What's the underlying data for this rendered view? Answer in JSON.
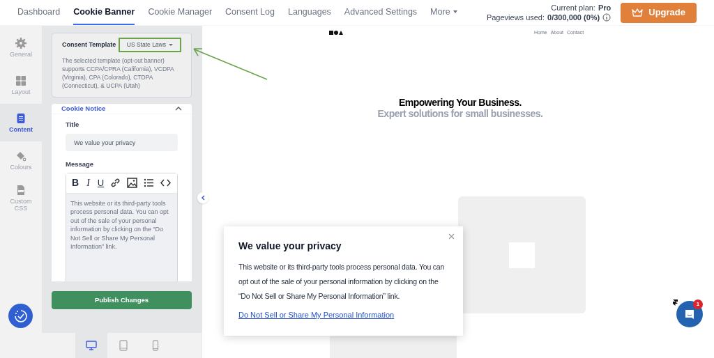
{
  "nav": {
    "tabs": [
      {
        "label": "Dashboard",
        "selected": false
      },
      {
        "label": "Cookie Banner",
        "selected": true
      },
      {
        "label": "Cookie Manager",
        "selected": false
      },
      {
        "label": "Consent Log",
        "selected": false
      },
      {
        "label": "Languages",
        "selected": false
      },
      {
        "label": "Advanced Settings",
        "selected": false
      },
      {
        "label": "More",
        "selected": false
      }
    ],
    "plan_label": "Current plan:",
    "plan": "Pro",
    "pageviews_label": "Pageviews used:",
    "pageviews": "0/300,000 (0%)",
    "upgrade": "Upgrade"
  },
  "sidebar": {
    "items": [
      {
        "kind": "gear",
        "label": "General",
        "selected": false
      },
      {
        "kind": "grid",
        "label": "Layout",
        "selected": false
      },
      {
        "kind": "doc",
        "label": "Content",
        "selected": true
      },
      {
        "kind": "paint",
        "label": "Colours",
        "selected": false
      },
      {
        "kind": "css",
        "label": "Custom CSS",
        "selected": false
      }
    ]
  },
  "template": {
    "label": "Consent Template",
    "value": "US State Laws",
    "description": "The selected template (opt-out banner) supports CCPA/CPRA (California), VCDPA (Virginia), CPA (Colorado), CTDPA (Connecticut), & UCPA (Utah)"
  },
  "cookie_notice": {
    "heading": "Cookie Notice",
    "expanded": true,
    "title_label": "Title",
    "title_value": "We value your privacy",
    "message_label": "Message",
    "message_value": "This website or its third-party tools process personal data. You can opt out of the sale of your personal information by clicking on the “Do Not Sell or Share My Personal Information” link."
  },
  "toolbar": [
    {
      "kind": "bold",
      "label": "B"
    },
    {
      "kind": "italic",
      "label": "I"
    },
    {
      "kind": "underline",
      "label": "U"
    }
  ],
  "publish": "Publish Changes",
  "devices": [
    {
      "kind": "desktop",
      "selected": true
    },
    {
      "kind": "tablet",
      "selected": false
    },
    {
      "kind": "phone",
      "selected": false
    }
  ],
  "preview": {
    "links": [
      "Home",
      "About",
      "Contact"
    ],
    "headline": "Empowering Your Business.",
    "subheadline": "Expert solutions for small businesses."
  },
  "banner": {
    "title": "We value your privacy",
    "message": "This website or its third-party tools process personal data. You can opt out of the sale of your personal information by clicking on the “Do Not Sell or Share My Personal Information” link.",
    "link": "Do Not Sell or Share My Personal Information"
  },
  "chat": {
    "badge": "1"
  }
}
